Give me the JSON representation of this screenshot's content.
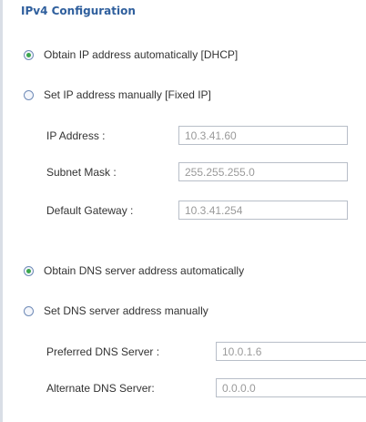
{
  "section_title": "IPv4 Configuration",
  "ip": {
    "auto_label": "Obtain IP address automatically [DHCP]",
    "auto_selected": true,
    "manual_label": "Set IP address manually [Fixed IP]",
    "manual_selected": false,
    "fields": {
      "ip_address": {
        "label": "IP Address :",
        "value": "10.3.41.60"
      },
      "subnet_mask": {
        "label": "Subnet Mask :",
        "value": "255.255.255.0"
      },
      "default_gateway": {
        "label": "Default Gateway :",
        "value": "10.3.41.254"
      }
    }
  },
  "dns": {
    "auto_label": "Obtain DNS server address automatically",
    "auto_selected": true,
    "manual_label": "Set DNS server address manually",
    "manual_selected": false,
    "fields": {
      "preferred": {
        "label": "Preferred DNS Server :",
        "value": "10.0.1.6"
      },
      "alternate": {
        "label": "Alternate DNS Server:",
        "value": "0.0.0.0"
      }
    }
  },
  "colors": {
    "title": "#2f5f9d",
    "radio_dot": "#3aa74c",
    "input_text": "#9a9a9a"
  }
}
